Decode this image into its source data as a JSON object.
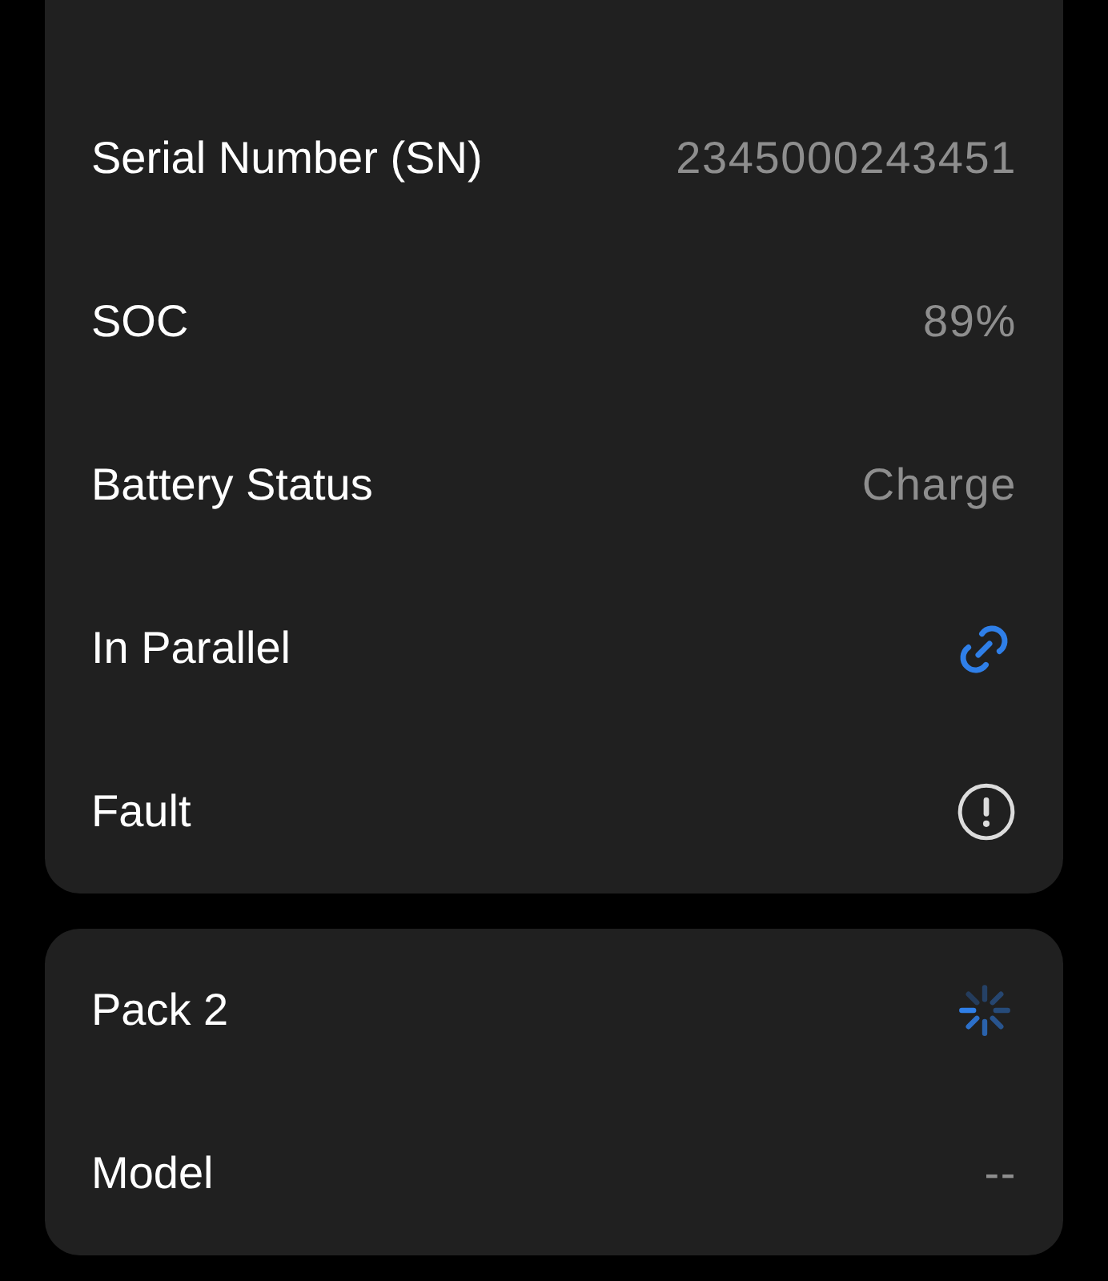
{
  "cards": [
    {
      "rows": [
        {
          "kind": "text",
          "label": "Serial Number (SN)",
          "value": "2345000243451"
        },
        {
          "kind": "text",
          "label": "SOC",
          "value": "89%"
        },
        {
          "kind": "text",
          "label": "Battery Status",
          "value": "Charge"
        },
        {
          "kind": "link",
          "label": "In Parallel"
        },
        {
          "kind": "alert",
          "label": "Fault"
        }
      ]
    },
    {
      "rows": [
        {
          "kind": "loading",
          "label": "Pack 2"
        },
        {
          "kind": "text",
          "label": "Model",
          "value": "--"
        }
      ]
    }
  ]
}
